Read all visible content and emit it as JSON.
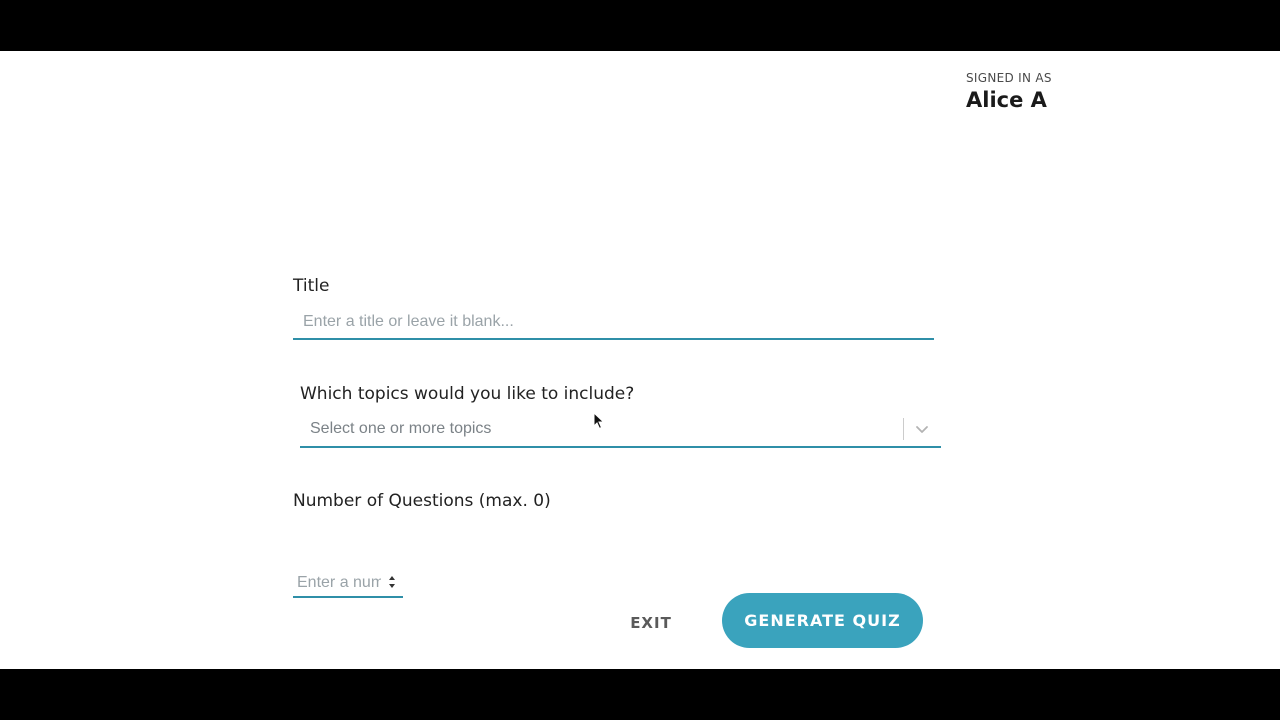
{
  "user": {
    "signed_in_label": "SIGNED IN AS",
    "name": "Alice A"
  },
  "form": {
    "title": {
      "label": "Title",
      "placeholder": "Enter a title or leave it blank...",
      "value": ""
    },
    "topics": {
      "label": "Which topics would you like to include?",
      "placeholder": "Select one or more topics",
      "icon": "chevron-down-icon"
    },
    "questions": {
      "label": "Number of Questions (max. 0)",
      "placeholder": "Enter a number",
      "value": "",
      "icon": "stepper-arrows-icon"
    }
  },
  "actions": {
    "exit_label": "EXIT",
    "generate_label": "GENERATE QUIZ"
  },
  "colors": {
    "accent": "#3aa3bd",
    "underline": "#2f8fa8",
    "letterbox": "#000000",
    "background": "#ffffff"
  }
}
